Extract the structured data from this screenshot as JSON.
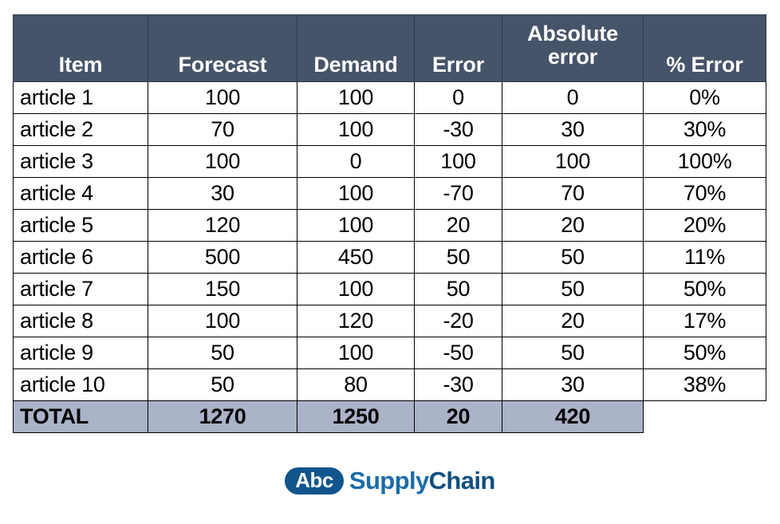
{
  "table": {
    "columns": [
      {
        "key": "item",
        "label": "Item",
        "lines": [
          "Item"
        ]
      },
      {
        "key": "forecast",
        "label": "Forecast",
        "lines": [
          "Forecast"
        ]
      },
      {
        "key": "demand",
        "label": "Demand",
        "lines": [
          "Demand"
        ]
      },
      {
        "key": "error",
        "label": "Error",
        "lines": [
          "Error"
        ]
      },
      {
        "key": "abserror",
        "label": "Absolute error",
        "lines": [
          "Absolute",
          "error"
        ]
      },
      {
        "key": "pcterror",
        "label": "% Error",
        "lines": [
          "% Error"
        ]
      }
    ],
    "rows": [
      {
        "item": "article 1",
        "forecast": "100",
        "demand": "100",
        "error": "0",
        "abserror": "0",
        "pcterror": "0%"
      },
      {
        "item": "article 2",
        "forecast": "70",
        "demand": "100",
        "error": "-30",
        "abserror": "30",
        "pcterror": "30%"
      },
      {
        "item": "article 3",
        "forecast": "100",
        "demand": "0",
        "error": "100",
        "abserror": "100",
        "pcterror": "100%"
      },
      {
        "item": "article 4",
        "forecast": "30",
        "demand": "100",
        "error": "-70",
        "abserror": "70",
        "pcterror": "70%"
      },
      {
        "item": "article 5",
        "forecast": "120",
        "demand": "100",
        "error": "20",
        "abserror": "20",
        "pcterror": "20%"
      },
      {
        "item": "article 6",
        "forecast": "500",
        "demand": "450",
        "error": "50",
        "abserror": "50",
        "pcterror": "11%"
      },
      {
        "item": "article 7",
        "forecast": "150",
        "demand": "100",
        "error": "50",
        "abserror": "50",
        "pcterror": "50%"
      },
      {
        "item": "article 8",
        "forecast": "100",
        "demand": "120",
        "error": "-20",
        "abserror": "20",
        "pcterror": "17%"
      },
      {
        "item": "article 9",
        "forecast": "50",
        "demand": "100",
        "error": "-50",
        "abserror": "50",
        "pcterror": "50%"
      },
      {
        "item": "article 10",
        "forecast": "50",
        "demand": "80",
        "error": "-30",
        "abserror": "30",
        "pcterror": "38%"
      }
    ],
    "total": {
      "item": "TOTAL",
      "forecast": "1270",
      "demand": "1250",
      "error": "20",
      "abserror": "420",
      "pcterror": ""
    }
  },
  "logo": {
    "badge_text": "Abc",
    "word_one": "Supply",
    "word_two": "Chain"
  },
  "colors": {
    "header_bg": "#465469",
    "header_text": "#ffffff",
    "total_row_bg": "#aab3c8",
    "cell_border": "#000000",
    "logo_badge_bg": "#10558c",
    "logo_word_one": "#1b6ca8",
    "logo_word_two": "#0d4f80"
  }
}
